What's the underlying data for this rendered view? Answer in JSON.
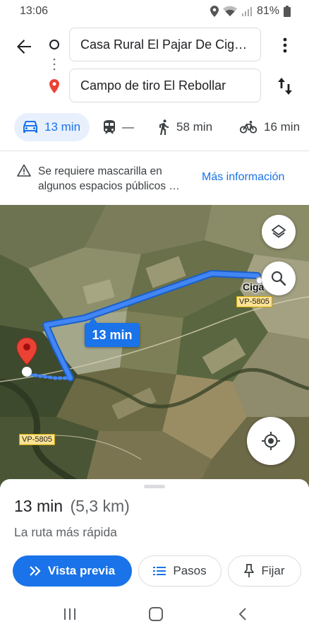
{
  "status_bar": {
    "time": "13:06",
    "battery": "81%"
  },
  "directions": {
    "origin": "Casa Rural El Pajar De Cig…",
    "destination": "Campo de tiro El Rebollar"
  },
  "modes": [
    {
      "name": "car",
      "value": "13 min",
      "selected": true
    },
    {
      "name": "transit",
      "value": "—"
    },
    {
      "name": "walk",
      "value": "58 min"
    },
    {
      "name": "bike",
      "value": "16 min"
    }
  ],
  "notice": {
    "text": "Se requiere mascarilla en algunos espacios públicos …",
    "link": "Más información"
  },
  "map": {
    "route_label": "13 min",
    "town_label": "Ciga",
    "road_badges": [
      "VP-5805",
      "VP-5805"
    ]
  },
  "sheet": {
    "duration": "13 min",
    "distance": "(5,3 km)",
    "subtitle": "La ruta más rápida",
    "preview_button": "Vista previa",
    "steps_button": "Pasos",
    "pin_button": "Fijar"
  },
  "colors": {
    "accent": "#1a73e8",
    "accent_light": "#e8f0fe",
    "destination_pin": "#ea4335",
    "route": "#4285f4"
  }
}
